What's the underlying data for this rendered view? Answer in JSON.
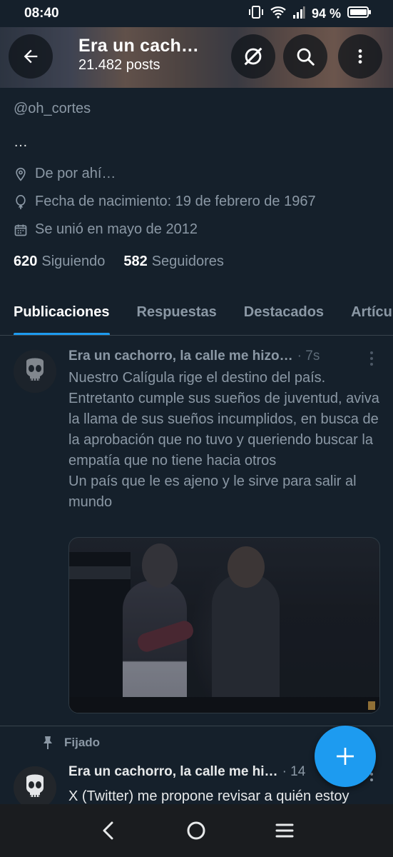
{
  "status_bar": {
    "time": "08:40",
    "battery": "94 %"
  },
  "header": {
    "title": "Era un cach…",
    "posts": "21.482 posts",
    "icons": [
      "back-arrow-icon",
      "spaces-off-icon",
      "search-icon",
      "more-vertical-icon"
    ]
  },
  "profile": {
    "handle": "@oh_cortes",
    "bio": "…",
    "location": "De por ahí…",
    "birthday": "Fecha de nacimiento: 19 de febrero de 1967",
    "joined": "Se unió en mayo de 2012",
    "following_count": "620",
    "following_label": "Siguiendo",
    "followers_count": "582",
    "followers_label": "Seguidores"
  },
  "tabs": [
    {
      "label": "Publicaciones",
      "active": true
    },
    {
      "label": "Respuestas",
      "active": false
    },
    {
      "label": "Destacados",
      "active": false
    },
    {
      "label": "Artículos",
      "active": false
    }
  ],
  "tweets": [
    {
      "name": "Era un cachorro, la calle me hizo…",
      "time": "· 7s",
      "text": "Nuestro Calígula rige el destino del país.\nEntretanto cumple sus sueños de juventud, aviva la llama de sus sueños incumplidos, en busca de la aprobación que no tuvo y queriendo buscar la empatía que no tiene hacia otros\nUn país que le es ajeno y le sirve para salir al mundo",
      "has_media": true
    },
    {
      "pinned_label": "Fijado",
      "name": "Era un cachorro, la calle me hi…",
      "time": "· 14",
      "text": "X (Twitter) me propone revisar a quién estoy"
    }
  ],
  "colors": {
    "background": "#15202b",
    "accent": "#1d9bf0",
    "muted": "#8b98a5",
    "divider": "#38444d"
  }
}
